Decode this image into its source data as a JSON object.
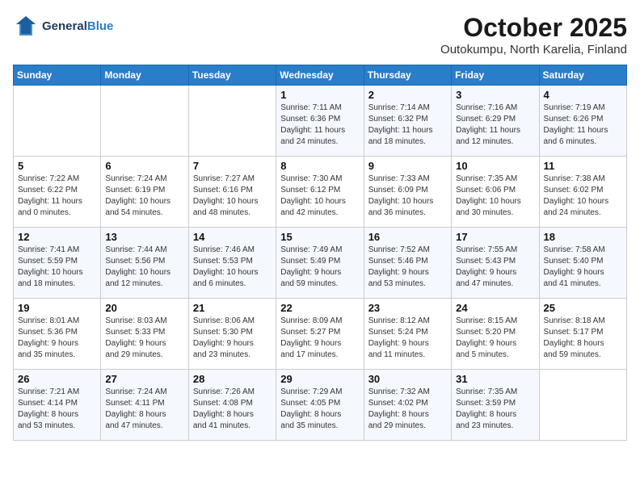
{
  "header": {
    "logo_line1": "General",
    "logo_line2": "Blue",
    "month_title": "October 2025",
    "location": "Outokumpu, North Karelia, Finland"
  },
  "days_of_week": [
    "Sunday",
    "Monday",
    "Tuesday",
    "Wednesday",
    "Thursday",
    "Friday",
    "Saturday"
  ],
  "weeks": [
    [
      {
        "day": "",
        "info": ""
      },
      {
        "day": "",
        "info": ""
      },
      {
        "day": "",
        "info": ""
      },
      {
        "day": "1",
        "info": "Sunrise: 7:11 AM\nSunset: 6:36 PM\nDaylight: 11 hours\nand 24 minutes."
      },
      {
        "day": "2",
        "info": "Sunrise: 7:14 AM\nSunset: 6:32 PM\nDaylight: 11 hours\nand 18 minutes."
      },
      {
        "day": "3",
        "info": "Sunrise: 7:16 AM\nSunset: 6:29 PM\nDaylight: 11 hours\nand 12 minutes."
      },
      {
        "day": "4",
        "info": "Sunrise: 7:19 AM\nSunset: 6:26 PM\nDaylight: 11 hours\nand 6 minutes."
      }
    ],
    [
      {
        "day": "5",
        "info": "Sunrise: 7:22 AM\nSunset: 6:22 PM\nDaylight: 11 hours\nand 0 minutes."
      },
      {
        "day": "6",
        "info": "Sunrise: 7:24 AM\nSunset: 6:19 PM\nDaylight: 10 hours\nand 54 minutes."
      },
      {
        "day": "7",
        "info": "Sunrise: 7:27 AM\nSunset: 6:16 PM\nDaylight: 10 hours\nand 48 minutes."
      },
      {
        "day": "8",
        "info": "Sunrise: 7:30 AM\nSunset: 6:12 PM\nDaylight: 10 hours\nand 42 minutes."
      },
      {
        "day": "9",
        "info": "Sunrise: 7:33 AM\nSunset: 6:09 PM\nDaylight: 10 hours\nand 36 minutes."
      },
      {
        "day": "10",
        "info": "Sunrise: 7:35 AM\nSunset: 6:06 PM\nDaylight: 10 hours\nand 30 minutes."
      },
      {
        "day": "11",
        "info": "Sunrise: 7:38 AM\nSunset: 6:02 PM\nDaylight: 10 hours\nand 24 minutes."
      }
    ],
    [
      {
        "day": "12",
        "info": "Sunrise: 7:41 AM\nSunset: 5:59 PM\nDaylight: 10 hours\nand 18 minutes."
      },
      {
        "day": "13",
        "info": "Sunrise: 7:44 AM\nSunset: 5:56 PM\nDaylight: 10 hours\nand 12 minutes."
      },
      {
        "day": "14",
        "info": "Sunrise: 7:46 AM\nSunset: 5:53 PM\nDaylight: 10 hours\nand 6 minutes."
      },
      {
        "day": "15",
        "info": "Sunrise: 7:49 AM\nSunset: 5:49 PM\nDaylight: 9 hours\nand 59 minutes."
      },
      {
        "day": "16",
        "info": "Sunrise: 7:52 AM\nSunset: 5:46 PM\nDaylight: 9 hours\nand 53 minutes."
      },
      {
        "day": "17",
        "info": "Sunrise: 7:55 AM\nSunset: 5:43 PM\nDaylight: 9 hours\nand 47 minutes."
      },
      {
        "day": "18",
        "info": "Sunrise: 7:58 AM\nSunset: 5:40 PM\nDaylight: 9 hours\nand 41 minutes."
      }
    ],
    [
      {
        "day": "19",
        "info": "Sunrise: 8:01 AM\nSunset: 5:36 PM\nDaylight: 9 hours\nand 35 minutes."
      },
      {
        "day": "20",
        "info": "Sunrise: 8:03 AM\nSunset: 5:33 PM\nDaylight: 9 hours\nand 29 minutes."
      },
      {
        "day": "21",
        "info": "Sunrise: 8:06 AM\nSunset: 5:30 PM\nDaylight: 9 hours\nand 23 minutes."
      },
      {
        "day": "22",
        "info": "Sunrise: 8:09 AM\nSunset: 5:27 PM\nDaylight: 9 hours\nand 17 minutes."
      },
      {
        "day": "23",
        "info": "Sunrise: 8:12 AM\nSunset: 5:24 PM\nDaylight: 9 hours\nand 11 minutes."
      },
      {
        "day": "24",
        "info": "Sunrise: 8:15 AM\nSunset: 5:20 PM\nDaylight: 9 hours\nand 5 minutes."
      },
      {
        "day": "25",
        "info": "Sunrise: 8:18 AM\nSunset: 5:17 PM\nDaylight: 8 hours\nand 59 minutes."
      }
    ],
    [
      {
        "day": "26",
        "info": "Sunrise: 7:21 AM\nSunset: 4:14 PM\nDaylight: 8 hours\nand 53 minutes."
      },
      {
        "day": "27",
        "info": "Sunrise: 7:24 AM\nSunset: 4:11 PM\nDaylight: 8 hours\nand 47 minutes."
      },
      {
        "day": "28",
        "info": "Sunrise: 7:26 AM\nSunset: 4:08 PM\nDaylight: 8 hours\nand 41 minutes."
      },
      {
        "day": "29",
        "info": "Sunrise: 7:29 AM\nSunset: 4:05 PM\nDaylight: 8 hours\nand 35 minutes."
      },
      {
        "day": "30",
        "info": "Sunrise: 7:32 AM\nSunset: 4:02 PM\nDaylight: 8 hours\nand 29 minutes."
      },
      {
        "day": "31",
        "info": "Sunrise: 7:35 AM\nSunset: 3:59 PM\nDaylight: 8 hours\nand 23 minutes."
      },
      {
        "day": "",
        "info": ""
      }
    ]
  ]
}
